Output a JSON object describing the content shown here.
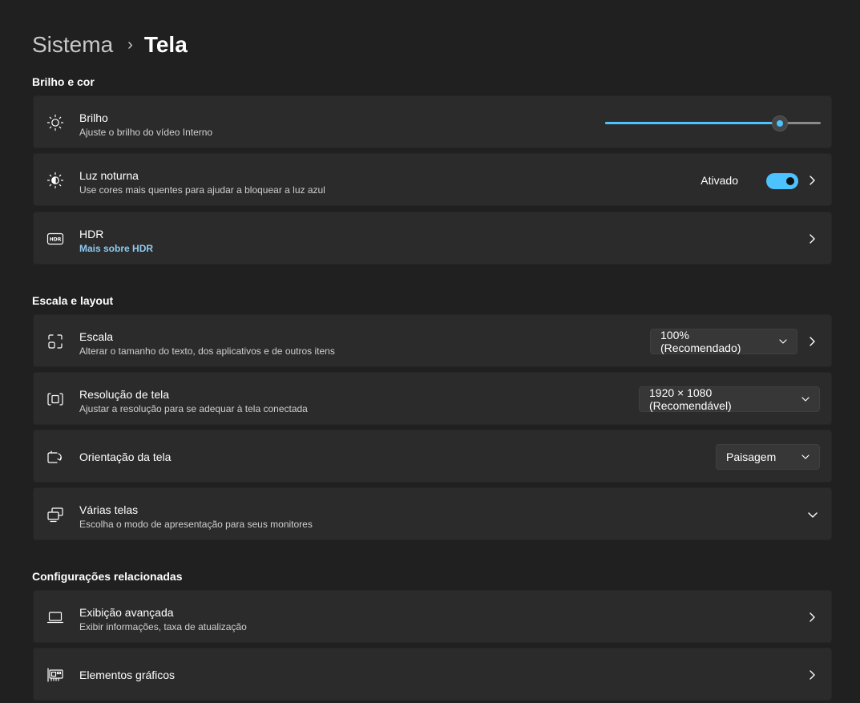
{
  "breadcrumb": {
    "parent": "Sistema",
    "separator": "›",
    "current": "Tela"
  },
  "sections": {
    "brightness_color": "Brilho e cor",
    "scale_layout": "Escala e layout",
    "related": "Configurações relacionadas"
  },
  "brightness": {
    "title": "Brilho",
    "subtitle": "Ajuste o brilho do vídeo Interno",
    "value_percent": 81,
    "icon": "sun-icon"
  },
  "night_light": {
    "title": "Luz noturna",
    "subtitle": "Use cores mais quentes para ajudar a bloquear a luz azul",
    "state": "Ativado",
    "on": true,
    "icon": "night-light-icon"
  },
  "hdr": {
    "title": "HDR",
    "link": "Mais sobre HDR",
    "icon": "hdr-icon"
  },
  "scale": {
    "title": "Escala",
    "subtitle": "Alterar o tamanho do texto, dos aplicativos e de outros itens",
    "value": "100% (Recomendado)",
    "icon": "scale-icon"
  },
  "resolution": {
    "title": "Resolução de tela",
    "subtitle": "Ajustar a resolução para se adequar à tela conectada",
    "value": "1920 × 1080 (Recomendável)",
    "icon": "resolution-icon"
  },
  "orientation": {
    "title": "Orientação da tela",
    "value": "Paisagem",
    "icon": "rotate-screen-icon"
  },
  "multiple_displays": {
    "title": "Várias telas",
    "subtitle": "Escolha o modo de apresentação para seus monitores",
    "icon": "multiple-displays-icon"
  },
  "advanced_display": {
    "title": "Exibição avançada",
    "subtitle": "Exibir informações, taxa de atualização",
    "icon": "laptop-icon"
  },
  "graphics": {
    "title": "Elementos gráficos",
    "icon": "graphics-card-icon"
  },
  "colors": {
    "background": "#202020",
    "card": "#2b2b2b",
    "accent": "#4cc2ff",
    "link": "#8ecaf0"
  }
}
